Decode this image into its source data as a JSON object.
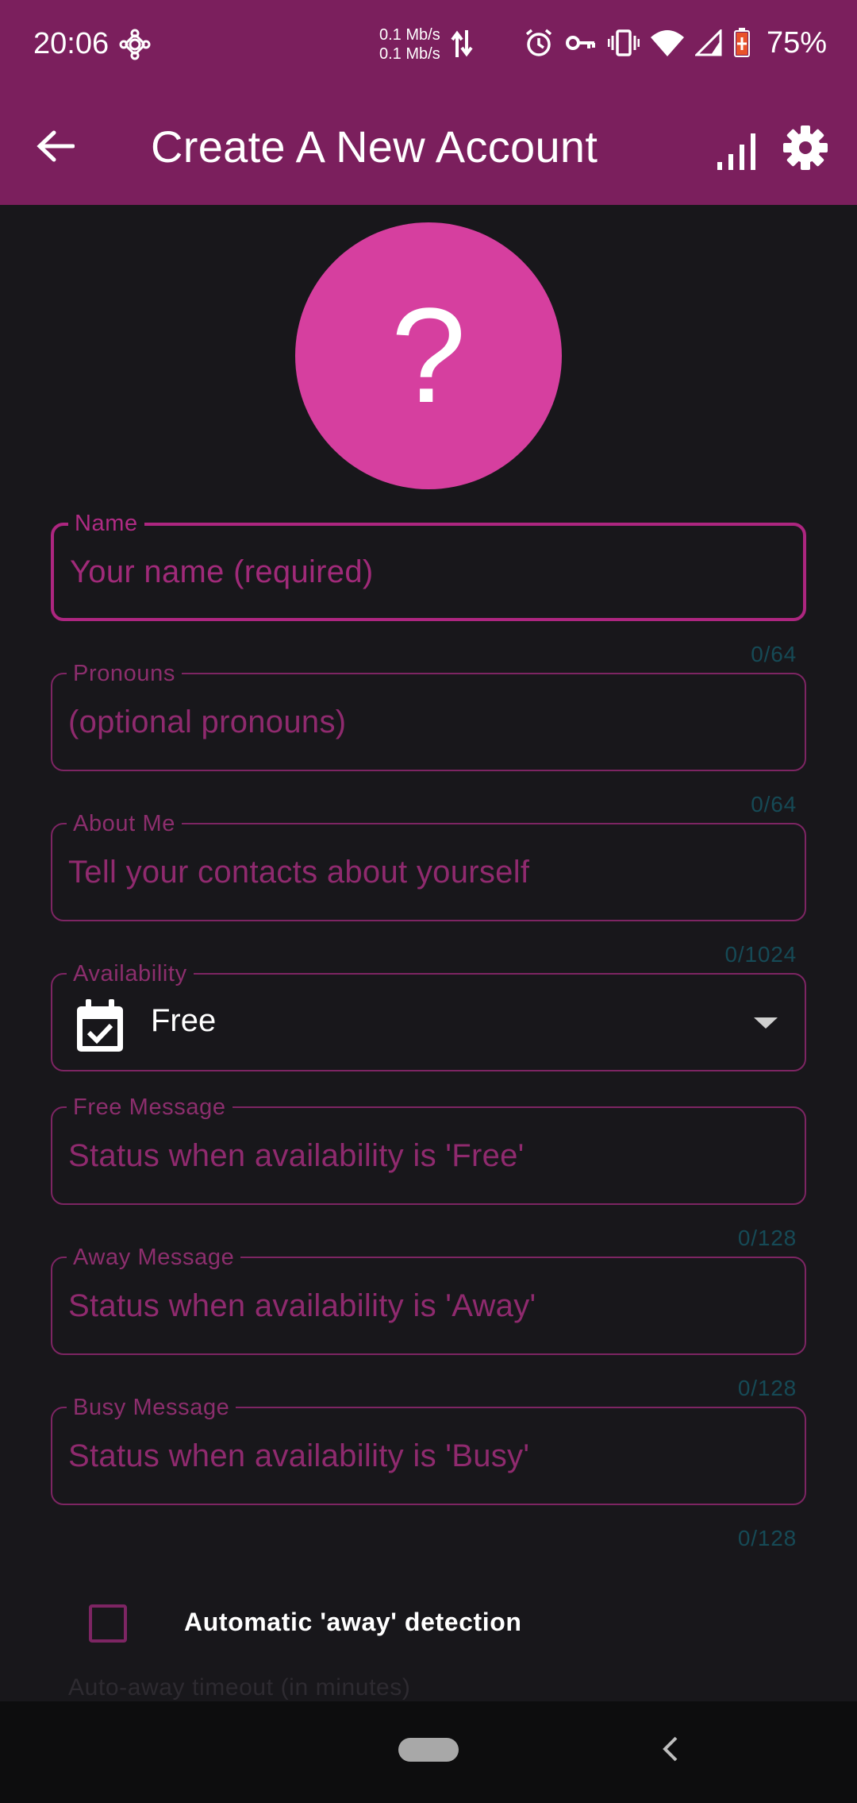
{
  "status": {
    "time": "20:06",
    "net_up": "0.1 Mb/s",
    "net_down": "0.1 Mb/s",
    "battery": "75%"
  },
  "appbar": {
    "title": "Create A New Account"
  },
  "avatar": {
    "symbol": "?"
  },
  "fields": {
    "name": {
      "label": "Name",
      "placeholder": "Your name (required)",
      "counter": "0/64"
    },
    "pronouns": {
      "label": "Pronouns",
      "placeholder": "(optional pronouns)",
      "counter": "0/64"
    },
    "about": {
      "label": "About Me",
      "placeholder": "Tell your contacts about yourself",
      "counter": "0/1024"
    },
    "availability": {
      "label": "Availability",
      "value": "Free"
    },
    "free_message": {
      "label": "Free Message",
      "placeholder": "Status when availability is 'Free'",
      "counter": "0/128"
    },
    "away_message": {
      "label": "Away Message",
      "placeholder": "Status when availability is 'Away'",
      "counter": "0/128"
    },
    "busy_message": {
      "label": "Busy Message",
      "placeholder": "Status when availability is 'Busy'",
      "counter": "0/128"
    }
  },
  "auto_away": {
    "label": "Automatic 'away' detection",
    "checked": false,
    "next_label_partial": "Auto-away timeout (in minutes)"
  },
  "colors": {
    "appbar": "#7b1f5d",
    "accent": "#ad2680",
    "avatar": "#d63f9f",
    "background": "#18171b"
  }
}
